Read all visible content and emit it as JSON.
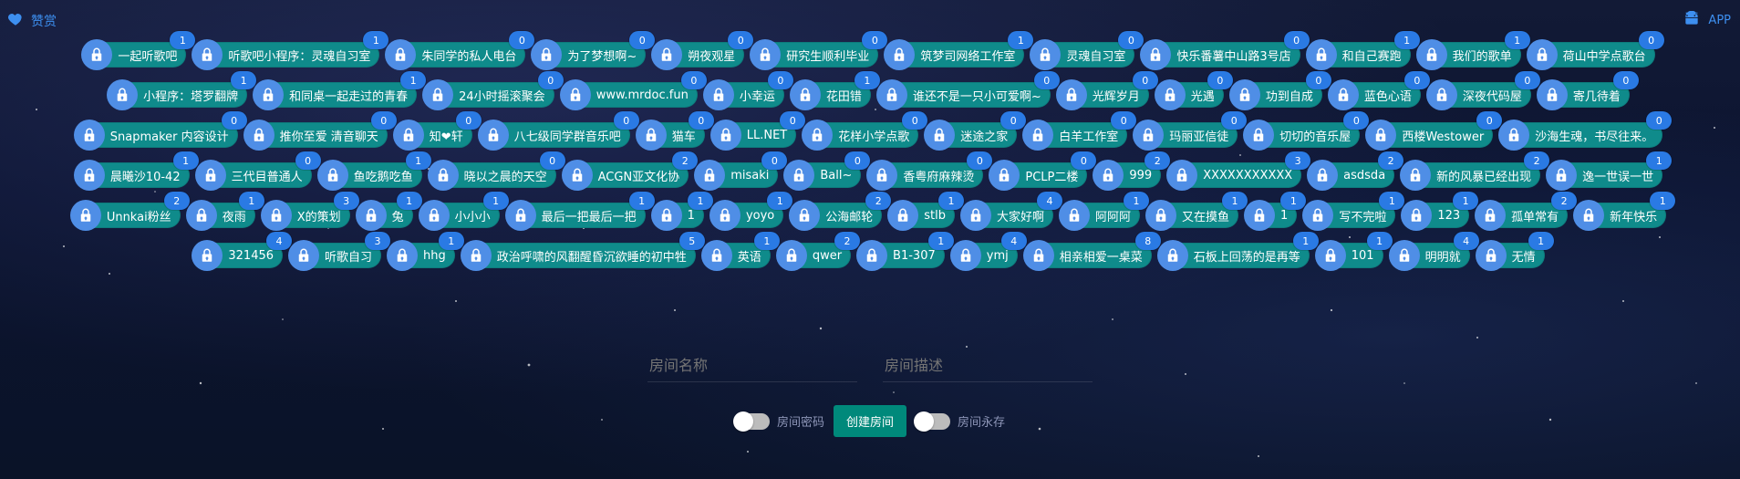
{
  "topbar": {
    "left_icon": "heart-icon",
    "left_label": "赞赏",
    "right_icon": "android-icon",
    "right_label": "APP",
    "accent": "#3d8ff0"
  },
  "rooms": {
    "row1": [
      {
        "name": "一起听歌吧",
        "count": "1"
      },
      {
        "name": "听歌吧小程序：灵魂自习室",
        "count": "1"
      },
      {
        "name": "朱同学的私人电台",
        "count": "0"
      },
      {
        "name": "为了梦想啊~",
        "count": "0"
      },
      {
        "name": "朔夜观星",
        "count": "0"
      },
      {
        "name": "研究生顺利毕业",
        "count": "0"
      },
      {
        "name": "筑梦司网络工作室",
        "count": "1"
      },
      {
        "name": "灵魂自习室",
        "count": "0"
      },
      {
        "name": "快乐番薯中山路3号店",
        "count": "0"
      },
      {
        "name": "和自己赛跑",
        "count": "1"
      },
      {
        "name": "我们的歌单",
        "count": "1"
      },
      {
        "name": "荷山中学点歌台",
        "count": "0"
      }
    ],
    "row2": [
      {
        "name": "小程序：塔罗翻牌",
        "count": "1"
      },
      {
        "name": "和同桌一起走过的青春",
        "count": "1"
      },
      {
        "name": "24小时摇滚聚会",
        "count": "0"
      },
      {
        "name": "www.mrdoc.fun",
        "count": "0"
      },
      {
        "name": "小幸运",
        "count": "0"
      },
      {
        "name": "花田错",
        "count": "1"
      },
      {
        "name": "谁还不是一只小可爱啊~",
        "count": "0"
      },
      {
        "name": "光辉岁月",
        "count": "0"
      },
      {
        "name": "光遇",
        "count": "0"
      },
      {
        "name": "功到自成",
        "count": "0"
      },
      {
        "name": "蓝色心语",
        "count": "0"
      },
      {
        "name": "深夜代码屋",
        "count": "0"
      },
      {
        "name": "寄几待着",
        "count": "0"
      }
    ],
    "row3": [
      {
        "name": "Snapmaker 内容设计",
        "count": "0"
      },
      {
        "name": "推你至爱 清音聊天",
        "count": "0"
      },
      {
        "name": "知❤轩",
        "count": "0"
      },
      {
        "name": "八七级同学群音乐吧",
        "count": "0"
      },
      {
        "name": "猫车",
        "count": "0"
      },
      {
        "name": "LL.NET",
        "count": "0"
      },
      {
        "name": "花样小学点歌",
        "count": "0"
      },
      {
        "name": "迷途之家",
        "count": "0"
      },
      {
        "name": "白羊工作室",
        "count": "0"
      },
      {
        "name": "玛丽亚信徒",
        "count": "0"
      },
      {
        "name": "切切的音乐屋",
        "count": "0"
      },
      {
        "name": "西楼Westower",
        "count": "0"
      },
      {
        "name": "沙海生魂，书尽往来。",
        "count": "0"
      }
    ],
    "row4": [
      {
        "name": "晨曦沙10-42",
        "count": "1"
      },
      {
        "name": "三代目普通人",
        "count": "0"
      },
      {
        "name": "鱼吃鹅吃鱼",
        "count": "1"
      },
      {
        "name": "晓以之晨的天空",
        "count": "0"
      },
      {
        "name": "ACGN亚文化协",
        "count": "2"
      },
      {
        "name": "misaki",
        "count": "0"
      },
      {
        "name": "Ball~",
        "count": "0"
      },
      {
        "name": "香粤府麻辣烫",
        "count": "0"
      },
      {
        "name": "PCLP二楼",
        "count": "0"
      },
      {
        "name": "999",
        "count": "2"
      },
      {
        "name": "XXXXXXXXXXX",
        "count": "3"
      },
      {
        "name": "asdsda",
        "count": "2"
      },
      {
        "name": "新的风暴已经出现",
        "count": "2"
      },
      {
        "name": "逸一世误一世",
        "count": "1"
      }
    ],
    "row5": [
      {
        "name": "Unnkai粉丝",
        "count": "2"
      },
      {
        "name": "夜雨",
        "count": "1"
      },
      {
        "name": "X的策划",
        "count": "3"
      },
      {
        "name": "兔",
        "count": "1"
      },
      {
        "name": "小小小",
        "count": "1"
      },
      {
        "name": "最后一把最后一把",
        "count": "1"
      },
      {
        "name": "1",
        "count": "1"
      },
      {
        "name": "yoyo",
        "count": "1"
      },
      {
        "name": "公海邮轮",
        "count": "2"
      },
      {
        "name": "stlb",
        "count": "1"
      },
      {
        "name": "大家好啊",
        "count": "4"
      },
      {
        "name": "阿阿阿",
        "count": "1"
      },
      {
        "name": "又在摸鱼",
        "count": "1"
      },
      {
        "name": "1",
        "count": "1"
      },
      {
        "name": "写不完啦",
        "count": "1"
      },
      {
        "name": "123",
        "count": "1"
      },
      {
        "name": "孤单常有",
        "count": "2"
      },
      {
        "name": "新年快乐",
        "count": "1"
      }
    ],
    "row6": [
      {
        "name": "321456",
        "count": "4"
      },
      {
        "name": "听歌自习",
        "count": "3"
      },
      {
        "name": "hhg",
        "count": "1"
      },
      {
        "name": "政治呼啸的风翻醒昏沉欲睡的初中牲",
        "count": "5"
      },
      {
        "name": "英语",
        "count": "1"
      },
      {
        "name": "qwer",
        "count": "2"
      },
      {
        "name": "B1-307",
        "count": "1"
      },
      {
        "name": "ymj",
        "count": "4"
      },
      {
        "name": "相亲相爱一桌菜",
        "count": "8"
      },
      {
        "name": "石板上回荡的是再等",
        "count": "1"
      },
      {
        "name": "101",
        "count": "1"
      },
      {
        "name": "明明就",
        "count": "4"
      },
      {
        "name": "无情",
        "count": "1"
      }
    ]
  },
  "form": {
    "room_name_placeholder": "房间名称",
    "room_desc_placeholder": "房间描述",
    "password_label": "房间密码",
    "create_label": "创建房间",
    "persist_label": "房间永存"
  },
  "colors": {
    "room_bg": "#0f8b8b",
    "lock_bg": "#4f8ee6",
    "badge_bg": "#2a7ae4",
    "create_button": "#00897b"
  }
}
